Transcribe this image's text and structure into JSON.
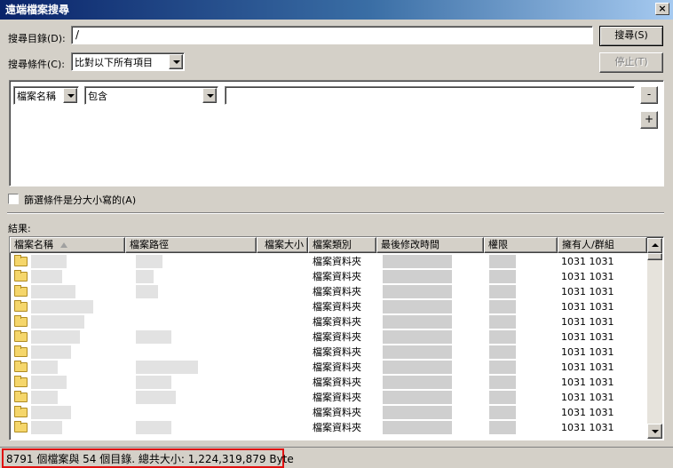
{
  "window": {
    "title": "遠端檔案搜尋",
    "close_glyph": "×"
  },
  "search": {
    "dir_label": "搜尋目錄(D):",
    "dir_value": "/",
    "cond_label": "搜尋條件(C):",
    "cond_value": "比對以下所有項目",
    "search_button": "搜尋(S)",
    "stop_button": "停止(T)"
  },
  "filter": {
    "field": "檔案名稱",
    "operator": "包含",
    "value": "",
    "remove_glyph": "-",
    "add_glyph": "+"
  },
  "case_checkbox": {
    "label": "篩選條件是分大小寫的(A)",
    "checked": false
  },
  "results": {
    "label": "結果:",
    "columns": [
      "檔案名稱",
      "檔案路徑",
      "檔案大小",
      "檔案類別",
      "最後修改時間",
      "權限",
      "擁有人/群組"
    ],
    "rows": [
      {
        "type": "檔案資料夾",
        "owner": "1031 1031"
      },
      {
        "type": "檔案資料夾",
        "owner": "1031 1031"
      },
      {
        "type": "檔案資料夾",
        "owner": "1031 1031"
      },
      {
        "type": "檔案資料夾",
        "owner": "1031 1031"
      },
      {
        "type": "檔案資料夾",
        "owner": "1031 1031"
      },
      {
        "type": "檔案資料夾",
        "owner": "1031 1031"
      },
      {
        "type": "檔案資料夾",
        "owner": "1031 1031"
      },
      {
        "type": "檔案資料夾",
        "owner": "1031 1031"
      },
      {
        "type": "檔案資料夾",
        "owner": "1031 1031"
      },
      {
        "type": "檔案資料夾",
        "owner": "1031 1031"
      },
      {
        "type": "檔案資料夾",
        "owner": "1031 1031"
      },
      {
        "type": "檔案資料夾",
        "owner": "1031 1031"
      }
    ]
  },
  "status": {
    "text": "8791 個檔案與 54 個目錄. 總共大小: 1,224,319,879 Byte",
    "highlight_color": "#e01010"
  },
  "icons": [
    "close-icon",
    "folder-icon",
    "sort-asc-icon",
    "dropdown-arrow-icon",
    "scroll-up-icon",
    "scroll-down-icon"
  ]
}
